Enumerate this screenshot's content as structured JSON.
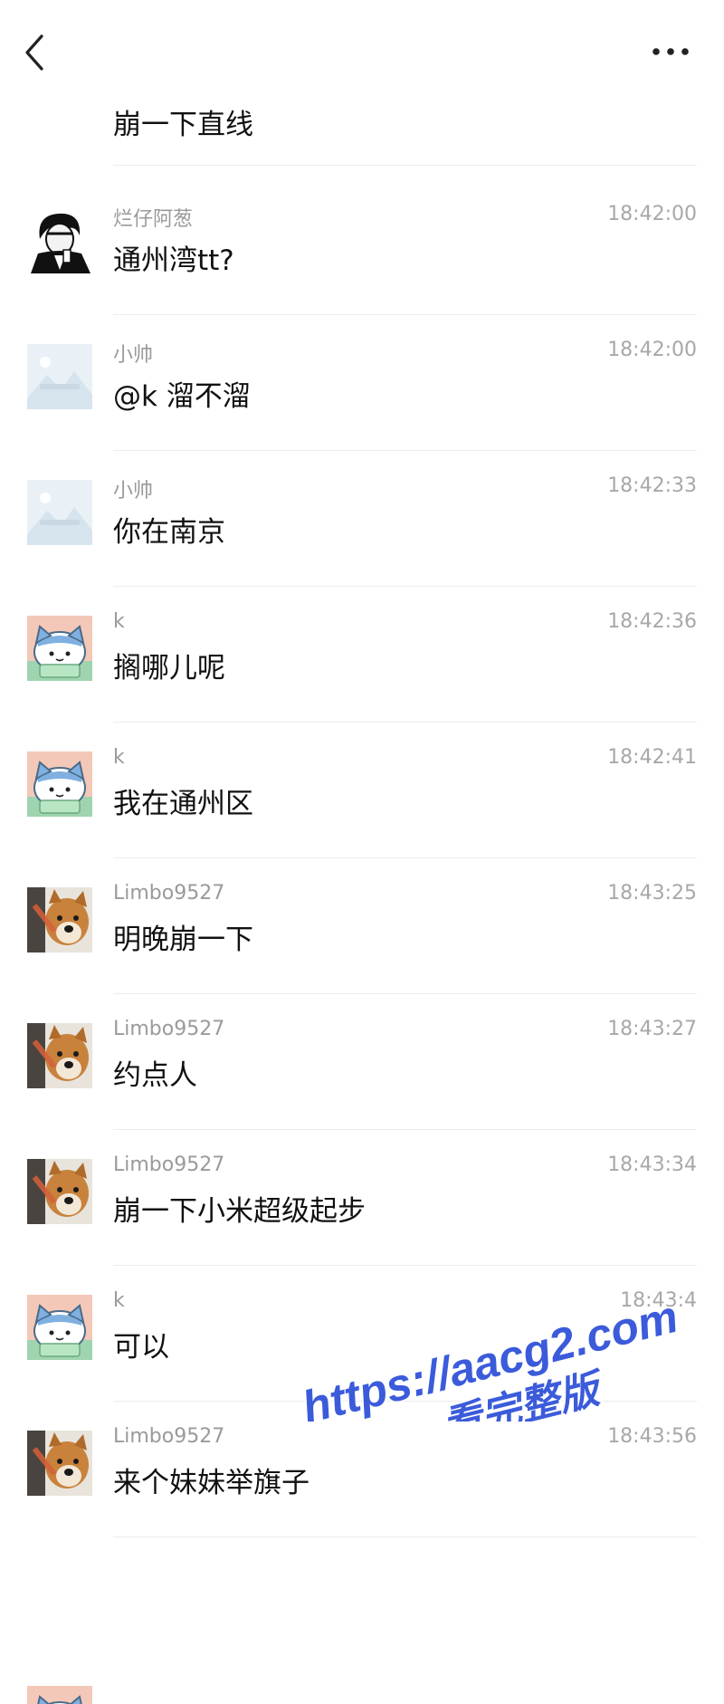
{
  "topbar": {
    "back_icon": "chevron-left-icon",
    "more_icon": "more-horizontal-icon"
  },
  "messages": [
    {
      "sender": "",
      "time": "",
      "text": "崩一下直线",
      "avatar": "cat"
    },
    {
      "sender": "烂仔阿葱",
      "time": "18:42:00",
      "text": "通州湾tt?",
      "avatar": "anime"
    },
    {
      "sender": "小帅",
      "time": "18:42:00",
      "text": "@k 溜不溜",
      "avatar": "placeholder"
    },
    {
      "sender": "小帅",
      "time": "18:42:33",
      "text": "你在南京",
      "avatar": "placeholder"
    },
    {
      "sender": "k",
      "time": "18:42:36",
      "text": "搁哪儿呢",
      "avatar": "cat"
    },
    {
      "sender": "k",
      "time": "18:42:41",
      "text": "我在通州区",
      "avatar": "cat"
    },
    {
      "sender": "Limbo9527",
      "time": "18:43:25",
      "text": "明晚崩一下",
      "avatar": "dog"
    },
    {
      "sender": "Limbo9527",
      "time": "18:43:27",
      "text": "约点人",
      "avatar": "dog"
    },
    {
      "sender": "Limbo9527",
      "time": "18:43:34",
      "text": "崩一下小米超级起步",
      "avatar": "dog"
    },
    {
      "sender": "k",
      "time": "18:43:4",
      "text": "可以",
      "avatar": "cat"
    },
    {
      "sender": "Limbo9527",
      "time": "18:43:56",
      "text": "来个妹妹举旗子",
      "avatar": "dog"
    }
  ],
  "watermark": {
    "line1": "https://aacg2.com",
    "line2": "看完整版",
    "color": "#3b5bdb"
  },
  "colors": {
    "sender": "#9a9a9a",
    "time": "#a8a8a8",
    "text": "#111111",
    "divider": "#ececec"
  }
}
